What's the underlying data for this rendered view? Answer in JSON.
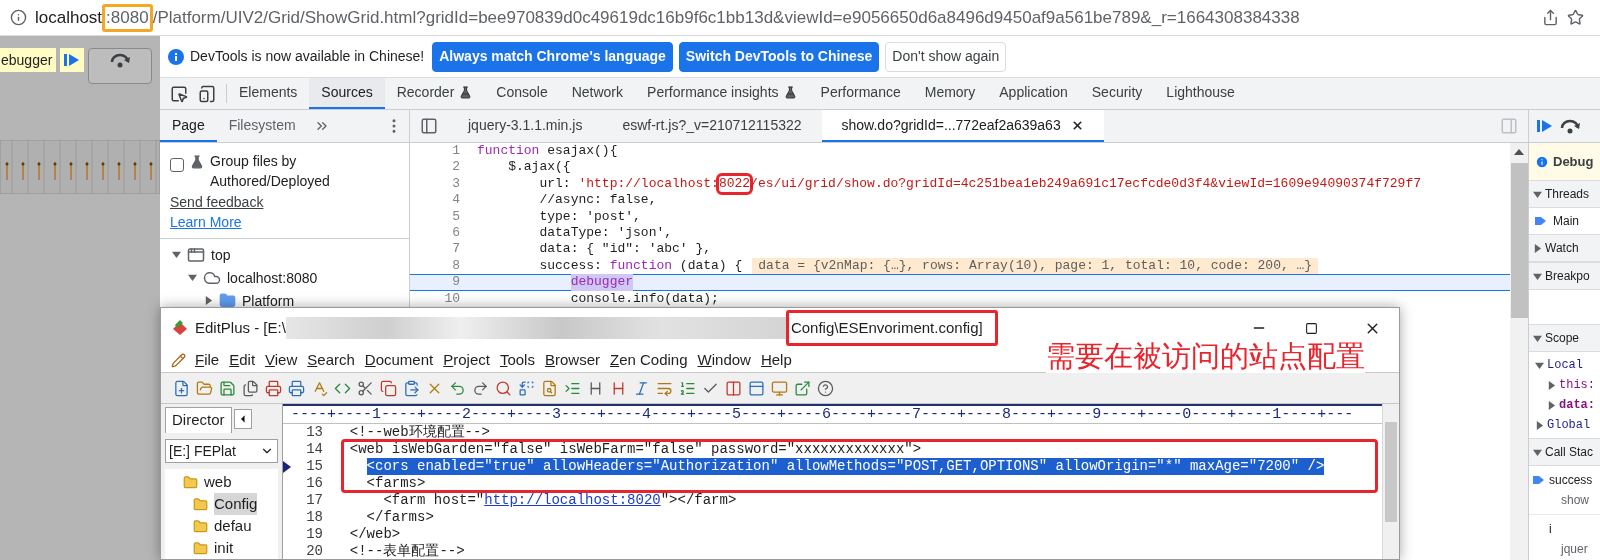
{
  "address_bar": {
    "host": "localhost",
    "port": ":8080",
    "path": "/Platform/UIV2/Grid/ShowGrid.html?gridId=bee970839d0c49619dc16b9f6c1bb13d&viewId=e9056650d6a8496d9450af9a561be789&_r=1664308384338"
  },
  "page_paused_label": "ebugger",
  "infobar": {
    "message": "DevTools is now available in Chinese!",
    "buttons": [
      {
        "label": "Always match Chrome's language",
        "kind": "primary"
      },
      {
        "label": "Switch DevTools to Chinese",
        "kind": "primary"
      },
      {
        "label": "Don't show again",
        "kind": "secondary"
      }
    ]
  },
  "tabs": [
    {
      "label": "Elements",
      "selected": false,
      "experimental": false
    },
    {
      "label": "Sources",
      "selected": true,
      "experimental": false
    },
    {
      "label": "Recorder",
      "selected": false,
      "experimental": true
    },
    {
      "label": "Console",
      "selected": false,
      "experimental": false
    },
    {
      "label": "Network",
      "selected": false,
      "experimental": false
    },
    {
      "label": "Performance insights",
      "selected": false,
      "experimental": true
    },
    {
      "label": "Performance",
      "selected": false,
      "experimental": false
    },
    {
      "label": "Memory",
      "selected": false,
      "experimental": false
    },
    {
      "label": "Application",
      "selected": false,
      "experimental": false
    },
    {
      "label": "Security",
      "selected": false,
      "experimental": false
    },
    {
      "label": "Lighthouse",
      "selected": false,
      "experimental": false
    }
  ],
  "navigator": {
    "tabs": [
      {
        "label": "Page",
        "selected": true
      },
      {
        "label": "Filesystem",
        "selected": false
      }
    ],
    "group_option": {
      "label": "Group files by Authored/Deployed",
      "checked": false
    },
    "links": [
      "Send feedback",
      "Learn More"
    ],
    "tree": [
      {
        "label": "top",
        "kind": "frame",
        "expanded": true,
        "children": [
          {
            "label": "localhost:8080",
            "kind": "cloud",
            "expanded": true,
            "children": [
              {
                "label": "Platform",
                "kind": "folder",
                "expanded": false
              }
            ]
          }
        ]
      }
    ]
  },
  "editor": {
    "file_tabs": [
      {
        "label": "jquery-3.1.1.min.js",
        "selected": false
      },
      {
        "label": "eswf-rt.js?_v=210712115322",
        "selected": false
      },
      {
        "label": "show.do?gridId=...772eaf2a639a63",
        "selected": true
      }
    ],
    "lines": [
      {
        "number": "1",
        "paused": false,
        "tokens": [
          {
            "kind": "keyword",
            "text": "function"
          },
          {
            "kind": "plain",
            "text": " esajax(){"
          }
        ]
      },
      {
        "number": "2",
        "paused": false,
        "tokens": [
          {
            "kind": "plain",
            "text": "    $.ajax({"
          }
        ]
      },
      {
        "number": "3",
        "paused": false,
        "tokens": [
          {
            "kind": "plain",
            "text": "        url: "
          },
          {
            "kind": "string",
            "text": "'http://localhost:"
          },
          {
            "kind": "framed",
            "text": "8022"
          },
          {
            "kind": "string",
            "text": "/es/ui/grid/show.do?gridId=4c251bea1eb249a691c17ecfcde0d3f4&viewId=1609e94090374f729f7"
          }
        ]
      },
      {
        "number": "4",
        "paused": false,
        "tokens": [
          {
            "kind": "plain",
            "text": "        //async: false,"
          }
        ]
      },
      {
        "number": "5",
        "paused": false,
        "tokens": [
          {
            "kind": "plain",
            "text": "        type: 'post',"
          }
        ]
      },
      {
        "number": "6",
        "paused": false,
        "tokens": [
          {
            "kind": "plain",
            "text": "        dataType: 'json',"
          }
        ]
      },
      {
        "number": "7",
        "paused": false,
        "tokens": [
          {
            "kind": "plain",
            "text": "        data: { \"id\": 'abc' },"
          }
        ]
      },
      {
        "number": "8",
        "paused": false,
        "tokens": [
          {
            "kind": "plain",
            "text": "        success: "
          },
          {
            "kind": "keyword",
            "text": "function"
          },
          {
            "kind": "plain",
            "text": " (data) {"
          }
        ],
        "inline_value": "data = {v2nMap: {…}, rows: Array(10), page: 1, total: 10, code: 200, …}"
      },
      {
        "number": "9",
        "paused": true,
        "tokens": [
          {
            "kind": "keyword",
            "text": "            debugger"
          }
        ]
      },
      {
        "number": "10",
        "paused": false,
        "tokens": [
          {
            "kind": "plain",
            "text": "            console.info(data);"
          }
        ]
      }
    ]
  },
  "debugger_sidebar": {
    "banner": "Debug",
    "sections": [
      {
        "kind": "threads",
        "title": "Threads",
        "expanded": true,
        "items": [
          "Main"
        ]
      },
      {
        "kind": "watch",
        "title": "Watch",
        "expanded": false
      },
      {
        "kind": "breakpoints",
        "title": "Breakpo",
        "expanded": true
      },
      {
        "kind": "scope",
        "title": "Scope",
        "expanded": true,
        "scopes": [
          {
            "label": "Local",
            "expanded": true,
            "children": [
              {
                "label": "this:",
                "expanded": false
              },
              {
                "label": "data:",
                "expanded": false
              }
            ]
          },
          {
            "label": "Global",
            "expanded": false
          }
        ]
      },
      {
        "kind": "callstack",
        "title": "Call Stac",
        "expanded": true,
        "frames": [
          {
            "name": "success",
            "location": "show",
            "current": true
          },
          {
            "name": "i",
            "location": "jquer",
            "current": false
          }
        ]
      }
    ]
  },
  "editplus": {
    "title_start": "EditPlus - [E:\\",
    "title_end": "Config\\ESEnvoriment.config]",
    "menu": [
      "File",
      "Edit",
      "View",
      "Search",
      "Document",
      "Project",
      "Tools",
      "Browser",
      "Zen Coding",
      "Window",
      "Help"
    ],
    "directory": {
      "tab": "Director",
      "drive": "[E:] FEPlat",
      "tree": [
        {
          "label": "web",
          "selected": false
        },
        {
          "label": "Config",
          "selected": true
        },
        {
          "label": "defau",
          "selected": false
        },
        {
          "label": "init",
          "selected": false
        }
      ]
    },
    "ruler": "----+----1----+----2----+----3----+----4----+----5----+----6----+----7----+----8----+----9----+----0----+----1----+---",
    "lines": [
      {
        "number": "13",
        "selected": false,
        "current": false,
        "tokens": [
          {
            "kind": "plain",
            "text": "  <!--web环境配置-->"
          }
        ]
      },
      {
        "number": "14",
        "selected": false,
        "current": false,
        "tokens": [
          {
            "kind": "plain",
            "text": "  <web isWebGarden=\"false\" isWebFarm=\"false\" password=\"xxxxxxxxxxxxx\">"
          }
        ]
      },
      {
        "number": "15",
        "selected": true,
        "current": true,
        "tokens": [
          {
            "kind": "plain",
            "text": "    <cors enabled=\"true\" allowHeaders=\"Authorization\" allowMethods=\"POST,GET,OPTIONS\" allowOrigin=\"*\" maxAge=\"7200\" />"
          }
        ]
      },
      {
        "number": "16",
        "selected": false,
        "current": false,
        "tokens": [
          {
            "kind": "plain",
            "text": "    <farms>"
          }
        ]
      },
      {
        "number": "17",
        "selected": false,
        "current": false,
        "tokens": [
          {
            "kind": "plain",
            "text": "      <farm host=\""
          },
          {
            "kind": "link",
            "text": "http://localhost:8020"
          },
          {
            "kind": "plain",
            "text": "\"></farm>"
          }
        ]
      },
      {
        "number": "18",
        "selected": false,
        "current": false,
        "tokens": [
          {
            "kind": "plain",
            "text": "    </farms>"
          }
        ]
      },
      {
        "number": "19",
        "selected": false,
        "current": false,
        "tokens": [
          {
            "kind": "plain",
            "text": "  </web>"
          }
        ]
      },
      {
        "number": "20",
        "selected": false,
        "current": false,
        "tokens": [
          {
            "kind": "plain",
            "text": "  <!--表单配置-->"
          }
        ]
      }
    ]
  },
  "annotation": "需要在被访问的站点配置"
}
